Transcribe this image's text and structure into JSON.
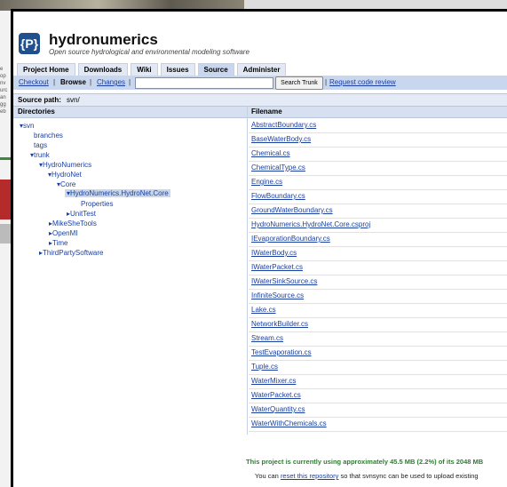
{
  "app": {
    "title": "hydronumerics",
    "subtitle": "Open source hydrological and environmental modeling software",
    "logo_text": "{P}"
  },
  "tabs": [
    "Project Home",
    "Downloads",
    "Wiki",
    "Issues",
    "Source",
    "Administer"
  ],
  "subnav": {
    "checkout": "Checkout",
    "browse": "Browse",
    "changes": "Changes",
    "separator": "|",
    "search_button": "Search Trunk",
    "request_review": "Request code review"
  },
  "source_path": {
    "label": "Source path:",
    "value": "svn/"
  },
  "columns": {
    "directories": "Directories",
    "filename": "Filename"
  },
  "tree": [
    "▾svn",
    "branches",
    "tags",
    "▾trunk",
    "▾HydroNumerics",
    "▾HydroNet",
    "▾Core",
    "▾HydroNumerics.HydroNet.Core",
    "Properties",
    "▸UnitTest",
    "▸MikeSheTools",
    "▸OpenMI",
    "▸Time",
    "▸ThirdPartySoftware"
  ],
  "files": [
    "AbstractBoundary.cs",
    "BaseWaterBody.cs",
    "Chemical.cs",
    "ChemicalType.cs",
    "Engine.cs",
    "FlowBoundary.cs",
    "GroundWaterBoundary.cs",
    "HydroNumerics.HydroNet.Core.csproj",
    "IEvaporationBoundary.cs",
    "IWaterBody.cs",
    "IWaterPacket.cs",
    "IWaterSinkSource.cs",
    "InfiniteSource.cs",
    "Lake.cs",
    "NetworkBuilder.cs",
    "Stream.cs",
    "TestEvaporation.cs",
    "Tuple.cs",
    "WaterMixer.cs",
    "WaterPacket.cs",
    "WaterQuantity.cs",
    "WaterWithChemicals.cs"
  ],
  "footer": {
    "usage": "This project is currently using approximately 45.5 MB (2.2%) of its 2048 MB",
    "line2_before": "You can",
    "reset_link": "reset this repository",
    "line2_after": "so that svnsync can be used to upload existing"
  }
}
